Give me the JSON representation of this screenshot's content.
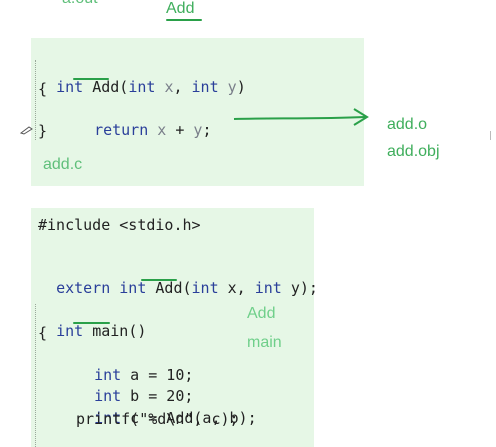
{
  "top": {
    "cropped_text": "a.out",
    "add_label": "Add"
  },
  "panel1": {
    "line1": {
      "kw1": "int",
      "fn": "Add",
      "open": "(",
      "kw2": "int",
      "p1": "x",
      "comma": ",",
      "kw3": "int",
      "p2": "y",
      "close": ")"
    },
    "line2": "{",
    "line3": {
      "ret": "return",
      "a": "x",
      "plus": "+",
      "b": "y",
      "semi": ";"
    },
    "line4": "}",
    "filename": "add.c"
  },
  "outputs": {
    "obj1": "add.o",
    "obj2": "add.obj"
  },
  "panel2": {
    "include": "#include <stdio.h>",
    "extern": {
      "kw1": "extern",
      "kw2": "int",
      "fn": "Add",
      "rest_open": "(",
      "kw3": "int",
      "p1": " x, ",
      "kw4": "int",
      "p2": " y);"
    },
    "main_sig": {
      "kw": "int",
      "fn": "main",
      "rest": "()"
    },
    "brace": "{",
    "decl_a": {
      "kw": "int",
      "rest": " a = 10;"
    },
    "decl_b": {
      "kw": "int",
      "rest": " b = 20;"
    },
    "decl_c": {
      "kw": "int",
      "rest": " c = Add(a, b);"
    },
    "printf": "printf(\"%d\\n\", c);"
  },
  "side_notes": {
    "add": "Add",
    "main": "main"
  },
  "colors": {
    "panel_bg": "#e6f7e6",
    "ink_green": "#2aa049",
    "keyword_blue": "#2a3f9a"
  }
}
